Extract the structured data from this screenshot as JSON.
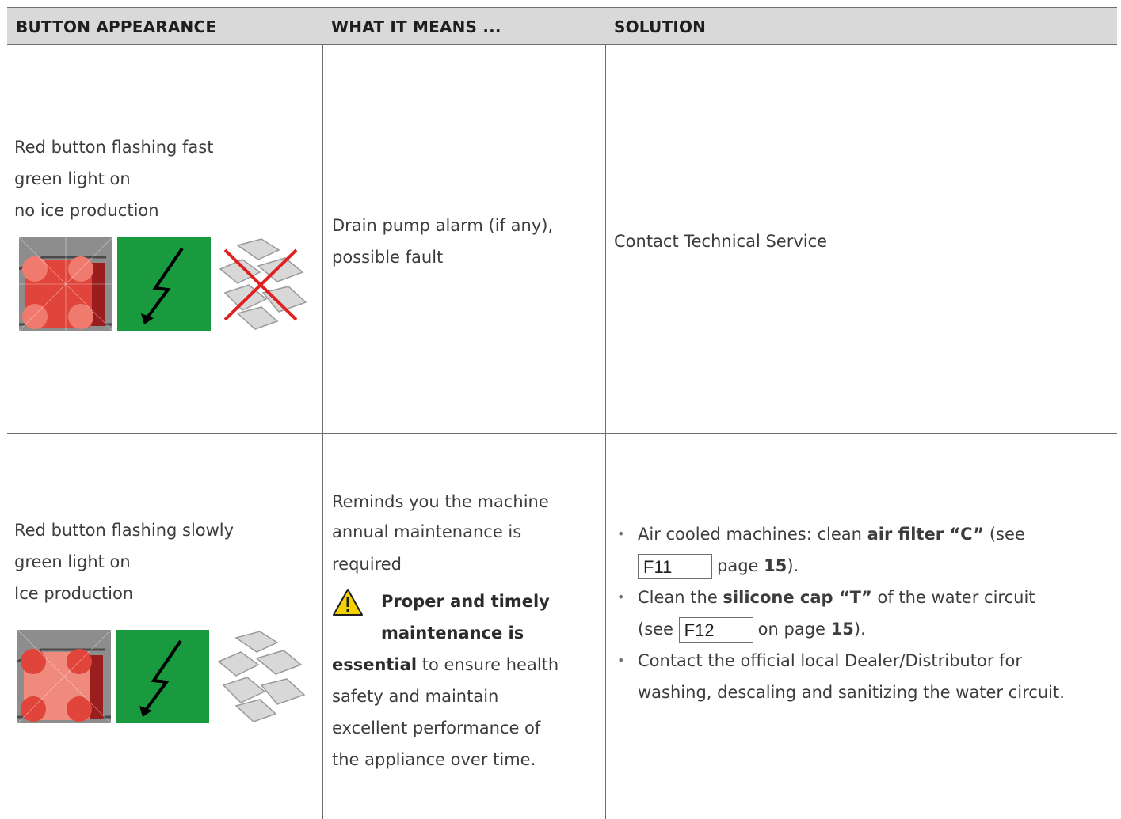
{
  "header": {
    "col1": "BUTTON APPEARANCE",
    "col2": "WHAT IT MEANS ...",
    "col3": "SOLUTION"
  },
  "rows": [
    {
      "appearance": [
        "Red button flashing fast",
        "green light on",
        "no ice production"
      ],
      "meaning": [
        "Drain pump alarm (if any),",
        "possible fault"
      ],
      "solution": "Contact Technical Service",
      "icons": [
        "red-button-icon",
        "power-lightning-icon",
        "no-ice-icon"
      ]
    },
    {
      "appearance": [
        "Red button flashing slowly",
        "green light on",
        "Ice production"
      ],
      "meaning": {
        "lines": [
          "Reminds you the machine",
          "annual maintenance is",
          "required"
        ],
        "warning_bold_1": "Proper and timely",
        "warning_bold_2": "maintenance is",
        "warning_bold_3": "essential",
        "rest_1": " to ensure health",
        "rest_lines": [
          "safety and maintain",
          "excellent performance of",
          "the appliance over time."
        ]
      },
      "solution": {
        "item1_pre": "Air cooled machines: clean ",
        "item1_bold": "air filter “C”",
        "item1_post": " (see",
        "item1_fig": "F11",
        "item1_page_pre": "page ",
        "item1_page": "15",
        "item1_end": ").",
        "item2_pre": "Clean the ",
        "item2_bold": "silicone cap “T”",
        "item2_post": " of the water circuit",
        "item2_see": "(see",
        "item2_fig": "F12",
        "item2_page_pre": "on page ",
        "item2_page": "15",
        "item2_end": ").",
        "item3": "Contact the official local Dealer/Distributor for washing, descaling and sanitizing the water circuit."
      },
      "icons": [
        "red-button-icon",
        "power-lightning-icon",
        "ice-icon"
      ]
    }
  ],
  "colors": {
    "header_bg": "#d9d9d9",
    "red": "#e8453c",
    "green": "#1a9a3e",
    "warning": "#f5d000"
  }
}
